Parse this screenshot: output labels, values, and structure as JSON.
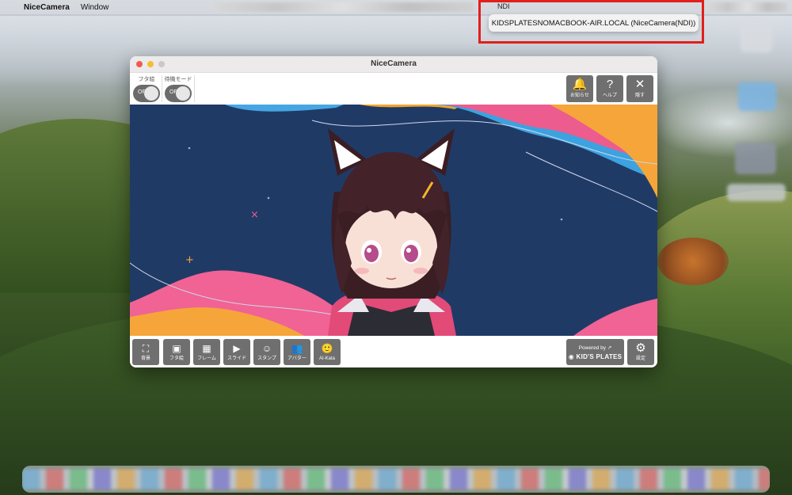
{
  "menubar": {
    "apple_glyph": "",
    "app_name": "NiceCamera",
    "menu_window": "Window"
  },
  "ndi": {
    "label": "NDI",
    "source_item": "KIDSPLATESNOMACBOOK-AIR.LOCAL (NiceCamera(NDI))"
  },
  "window": {
    "title": "NiceCamera",
    "toggles": [
      {
        "label": "フタ絵",
        "state": "OFF"
      },
      {
        "label": "待機モード",
        "state": "OFF"
      }
    ],
    "top_buttons": [
      {
        "icon": "bell-icon",
        "glyph": "🔔",
        "label": "お知らせ"
      },
      {
        "icon": "question-icon",
        "glyph": "?",
        "label": "ヘルプ"
      },
      {
        "icon": "close-icon",
        "glyph": "✕",
        "label": "隠す"
      }
    ],
    "bottom_buttons": [
      {
        "icon": "background-icon",
        "glyph": "⛶",
        "label": "背景"
      },
      {
        "icon": "lid-image-icon",
        "glyph": "▣",
        "label": "フタ絵"
      },
      {
        "icon": "frame-icon",
        "glyph": "▦",
        "label": "フレーム"
      },
      {
        "icon": "slide-icon",
        "glyph": "▶",
        "label": "スライド"
      },
      {
        "icon": "stamp-icon",
        "glyph": "☺",
        "label": "スタンプ"
      },
      {
        "icon": "avatar-icon",
        "glyph": "👥",
        "label": "アバター"
      },
      {
        "icon": "ai-kata-icon",
        "glyph": "🙂",
        "label": "AI-Kata"
      }
    ],
    "powered_by": {
      "line1": "Powered by ↗",
      "line2": "◉ KID'S PLATES"
    },
    "settings_button": {
      "icon": "gear-icon",
      "glyph": "⚙",
      "label": "設定"
    }
  },
  "colors": {
    "stage_bg": "#203a66",
    "accent_red": "#e0201c",
    "button_gray": "#6f6f6f"
  }
}
